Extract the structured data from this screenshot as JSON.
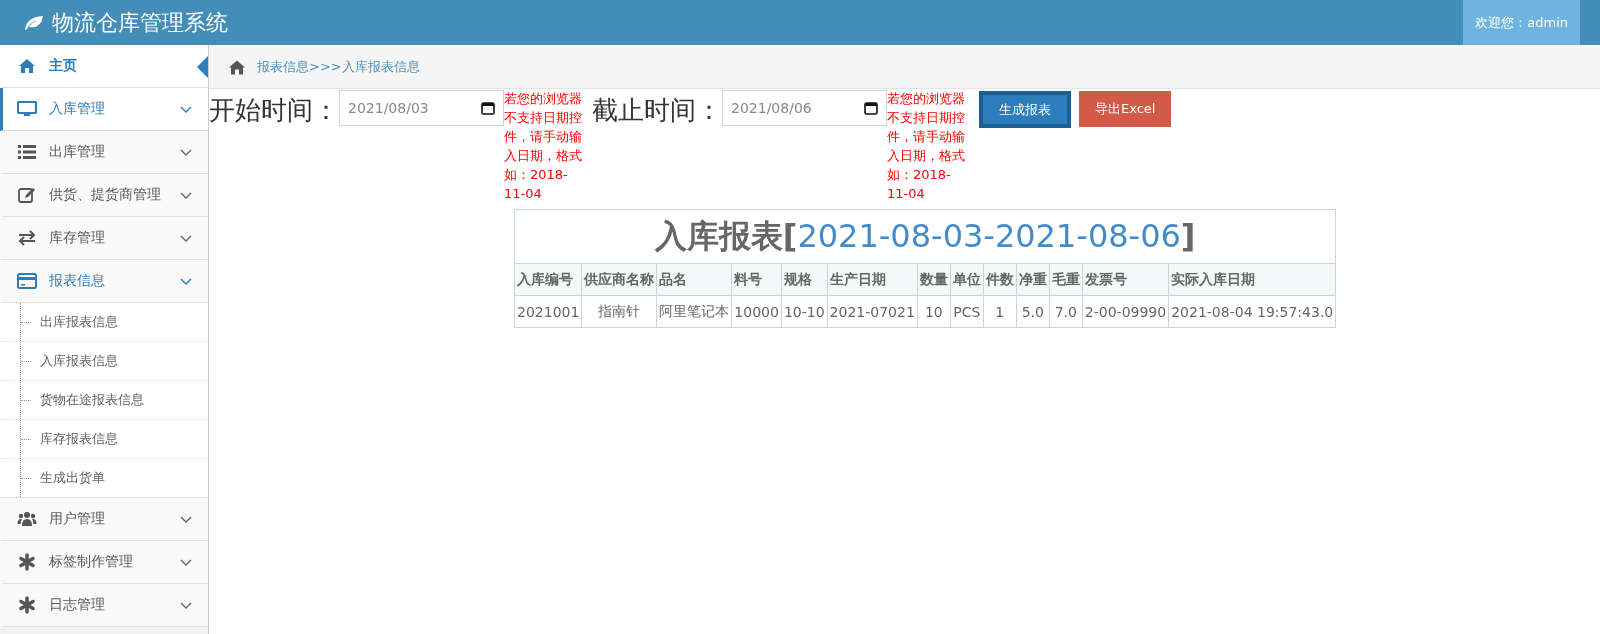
{
  "header": {
    "title": "物流仓库管理系统",
    "welcome": "欢迎您：admin"
  },
  "sidebar": {
    "items": [
      {
        "kind": "home",
        "label": "主页",
        "selected": true,
        "active": false
      },
      {
        "kind": "monitor",
        "label": "入库管理",
        "selected": false,
        "active": true,
        "expanded": false
      },
      {
        "kind": "list",
        "label": "出库管理",
        "selected": false,
        "active": false,
        "expanded": false
      },
      {
        "kind": "edit",
        "label": "供货、提货商管理",
        "selected": false,
        "active": false,
        "expanded": false
      },
      {
        "kind": "exchange",
        "label": "库存管理",
        "selected": false,
        "active": false,
        "expanded": false
      },
      {
        "kind": "card",
        "label": "报表信息",
        "selected": false,
        "active": false,
        "expanded": true,
        "children": [
          {
            "label": "出库报表信息"
          },
          {
            "label": "入库报表信息"
          },
          {
            "label": "货物在途报表信息"
          },
          {
            "label": "库存报表信息"
          },
          {
            "label": "生成出货单"
          }
        ]
      },
      {
        "kind": "users",
        "label": "用户管理",
        "selected": false,
        "active": false,
        "expanded": false
      },
      {
        "kind": "asterisk",
        "label": "标签制作管理",
        "selected": false,
        "active": false,
        "expanded": false
      },
      {
        "kind": "asterisk",
        "label": "日志管理",
        "selected": false,
        "active": false,
        "expanded": false
      }
    ]
  },
  "breadcrumb": "报表信息>>>入库报表信息",
  "filters": [
    {
      "label": "开始时间：",
      "value": "2021/08/03",
      "note": "若您的浏览器不支持日期控件，请手动输入日期，格式如：2018-11-04"
    },
    {
      "label": "截止时间：",
      "value": "2021/08/06",
      "note": "若您的浏览器不支持日期控件，请手动输入日期，格式如：2018-11-04"
    }
  ],
  "buttons": [
    {
      "kind": "primary",
      "label": "生成报表"
    },
    {
      "kind": "danger",
      "label": "导出Excel"
    }
  ],
  "report": {
    "title": "入库报表",
    "open": "[",
    "range": "2021-08-03-2021-08-06",
    "close": "]",
    "columns": [
      "入库编号",
      "供应商名称",
      "品名",
      "料号",
      "规格",
      "生产日期",
      "数量",
      "单位",
      "件数",
      "净重",
      "毛重",
      "发票号",
      "实际入库日期"
    ],
    "rows": [
      [
        "2021001",
        "指南针",
        "阿里笔记本",
        "10000",
        "10-10",
        "2021-07021",
        "10",
        "PCS",
        "1",
        "5.0",
        "7.0",
        "2-00-09990",
        "2021-08-04 19:57:43.0"
      ]
    ]
  }
}
